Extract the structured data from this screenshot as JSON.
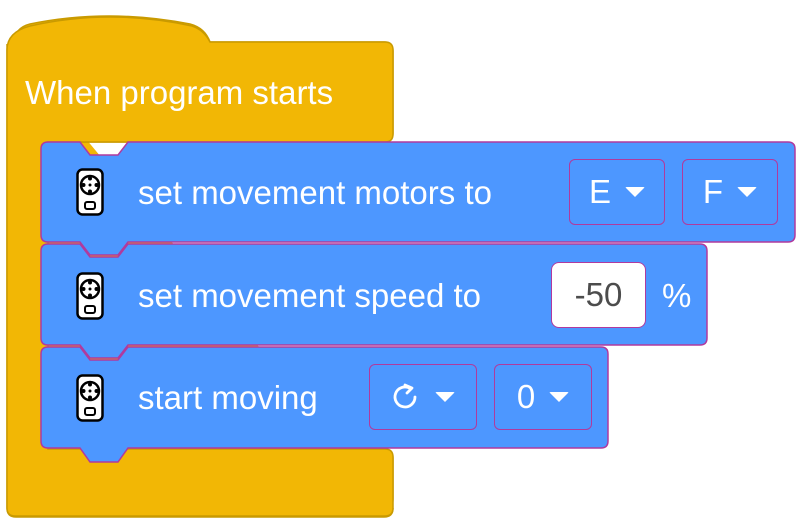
{
  "colors": {
    "hat": "#f2b705",
    "hat_border": "#c99a00",
    "motion": "#4d97ff",
    "motion_border": "#b03a9e"
  },
  "hat": {
    "label": "When program starts"
  },
  "blocks": [
    {
      "icon": "remote-controller-icon",
      "label": "set movement motors to",
      "dropdowns": [
        "E",
        "F"
      ]
    },
    {
      "icon": "remote-controller-icon",
      "label": "set movement speed to",
      "input": "-50",
      "suffix": "%"
    },
    {
      "icon": "remote-controller-icon",
      "label": "start moving",
      "direction_icon": "clockwise-rotate-icon",
      "dropdown": "0"
    }
  ]
}
